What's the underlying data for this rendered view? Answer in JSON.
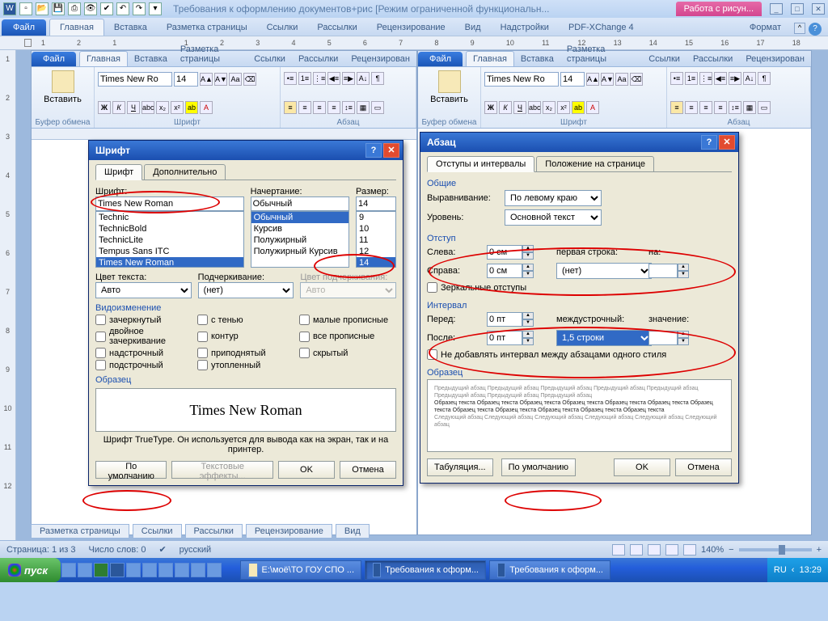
{
  "qat_icons": [
    "W",
    "□",
    "▣",
    "▤",
    "⎙",
    "✎",
    "↶",
    "↷",
    "▾"
  ],
  "title": "Требования к оформлению документов+рис [Режим ограниченной функциональн...",
  "pink_tab": "Работа с рисун...",
  "win_controls": [
    "_",
    "□",
    "✕"
  ],
  "ribbon": {
    "file": "Файл",
    "tabs": [
      "Главная",
      "Вставка",
      "Разметка страницы",
      "Ссылки",
      "Рассылки",
      "Рецензирование",
      "Вид",
      "Надстройки",
      "PDF-XChange 4"
    ],
    "format": "Формат"
  },
  "ruler_h": [
    "1",
    "2",
    "1",
    "",
    "1",
    "2",
    "3",
    "4",
    "5",
    "6",
    "7",
    "8",
    "9",
    "10",
    "11",
    "12",
    "13",
    "14",
    "15",
    "16",
    "17",
    "18"
  ],
  "ruler_v": [
    "",
    "1",
    "2",
    "3",
    "4",
    "5",
    "6",
    "7",
    "8",
    "9",
    "10",
    "11",
    "12"
  ],
  "inner_ribbon": {
    "file": "Файл",
    "tabs": [
      "Главная",
      "Вставка",
      "Разметка страницы",
      "Ссылки",
      "Рассылки",
      "Рецензирован"
    ],
    "groups": {
      "paste": "Вставить",
      "clipboard": "Буфер обмена",
      "font_name": "Times New Ro",
      "font_size": "14",
      "font_group": "Шрифт",
      "para_group": "Абзац",
      "bold": "Ж",
      "italic": "К",
      "uline": "Ч"
    }
  },
  "font_dialog": {
    "title": "Шрифт",
    "tabs": [
      "Шрифт",
      "Дополнительно"
    ],
    "labels": {
      "font": "Шрифт:",
      "style": "Начертание:",
      "size": "Размер:",
      "fontcolor": "Цвет текста:",
      "uline": "Подчеркивание:",
      "ulinecolor": "Цвет подчеркивания:"
    },
    "font_value": "Times New Roman",
    "font_list": [
      "Technic",
      "TechnicBold",
      "TechnicLite",
      "Tempus Sans ITC",
      "Times New Roman"
    ],
    "style_value": "Обычный",
    "style_list": [
      "Обычный",
      "Курсив",
      "Полужирный",
      "Полужирный Курсив"
    ],
    "size_value": "14",
    "size_list": [
      "9",
      "10",
      "11",
      "12",
      "14"
    ],
    "color_auto": "Авто",
    "uline_none": "(нет)",
    "uline_auto": "Авто",
    "effects_title": "Видоизменение",
    "effects": [
      "зачеркнутый",
      "двойное зачеркивание",
      "надстрочный",
      "подстрочный",
      "с тенью",
      "контур",
      "приподнятый",
      "утопленный",
      "малые прописные",
      "все прописные",
      "скрытый"
    ],
    "sample_title": "Образец",
    "sample_text": "Times New Roman",
    "truetype_note": "Шрифт TrueType. Он используется для вывода как на экран, так и на принтер.",
    "default_btn": "По умолчанию",
    "text_effects": "Текстовые эффекты...",
    "ok": "OK",
    "cancel": "Отмена"
  },
  "para_dialog": {
    "title": "Абзац",
    "tabs": [
      "Отступы и интервалы",
      "Положение на странице"
    ],
    "general": "Общие",
    "align_lbl": "Выравнивание:",
    "align_val": "По левому краю",
    "level_lbl": "Уровень:",
    "level_val": "Основной текст",
    "indent": "Отступ",
    "left_lbl": "Слева:",
    "left_val": "0 см",
    "right_lbl": "Справа:",
    "right_val": "0 см",
    "first_lbl": "первая строка:",
    "on_lbl": "на:",
    "first_val": "(нет)",
    "mirror": "Зеркальные отступы",
    "spacing": "Интервал",
    "before_lbl": "Перед:",
    "before_val": "0 пт",
    "after_lbl": "После:",
    "after_val": "0 пт",
    "line_lbl": "междустрочный:",
    "value_lbl": "значение:",
    "line_val": "1,5 строки",
    "no_space": "Не добавлять интервал между абзацами одного стиля",
    "sample": "Образец",
    "tabs_btn": "Табуляция...",
    "default_btn": "По умолчанию",
    "ok": "OK",
    "cancel": "Отмена"
  },
  "bottom_tabs": [
    "Разметка страницы",
    "Ссылки",
    "Рассылки",
    "Рецензирование",
    "Вид"
  ],
  "status": {
    "page": "Страница: 1 из 3",
    "words": "Число слов: 0",
    "lang": "русский",
    "zoom": "140%"
  },
  "taskbar": {
    "start": "пуск",
    "tasks": [
      "Е:\\моё\\ТО ГОУ СПО ...",
      "Требования к оформ...",
      "Требования к оформ..."
    ],
    "lang": "RU",
    "time": "13:29"
  }
}
